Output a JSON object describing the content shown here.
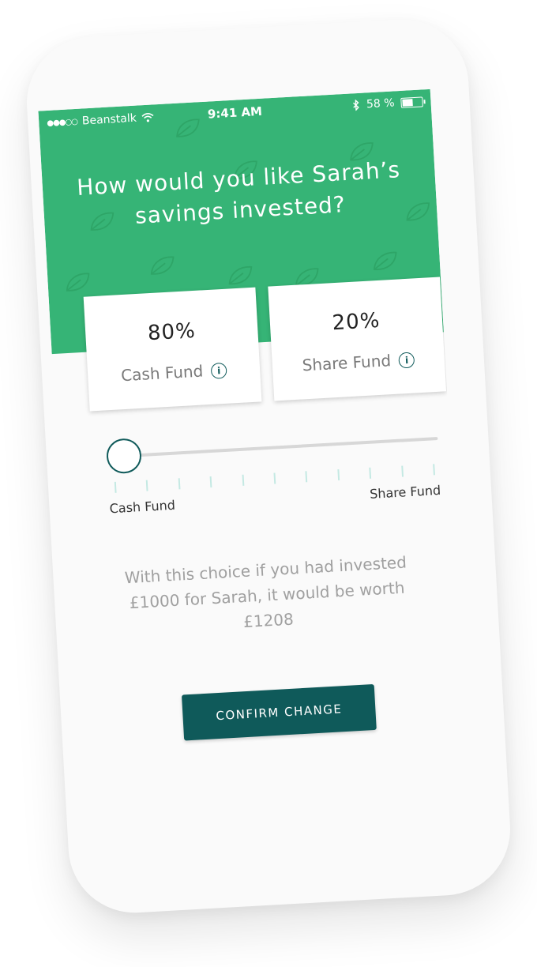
{
  "status_bar": {
    "signal": "●●●○○",
    "carrier": "Beanstalk",
    "time": "9:41 AM",
    "battery_pct": "58 %",
    "battery_level": 0.58
  },
  "header": {
    "title": "How would you like Sarah’s savings invested?"
  },
  "funds": [
    {
      "percent": "80%",
      "label": "Cash Fund",
      "info_icon": "info-icon"
    },
    {
      "percent": "20%",
      "label": "Share Fund",
      "info_icon": "info-icon"
    }
  ],
  "slider": {
    "value": 0,
    "min_label": "Cash Fund",
    "max_label": "Share Fund",
    "tick_count": 11
  },
  "summary": {
    "text": "With this choice if you had invested £1000 for Sarah, it would be worth £1208"
  },
  "confirm_button": {
    "label": "CONFIRM CHANGE"
  },
  "colors": {
    "header_green": "#36b476",
    "dark_teal": "#0f5a5a",
    "tick_mint": "#c4e9e3"
  }
}
